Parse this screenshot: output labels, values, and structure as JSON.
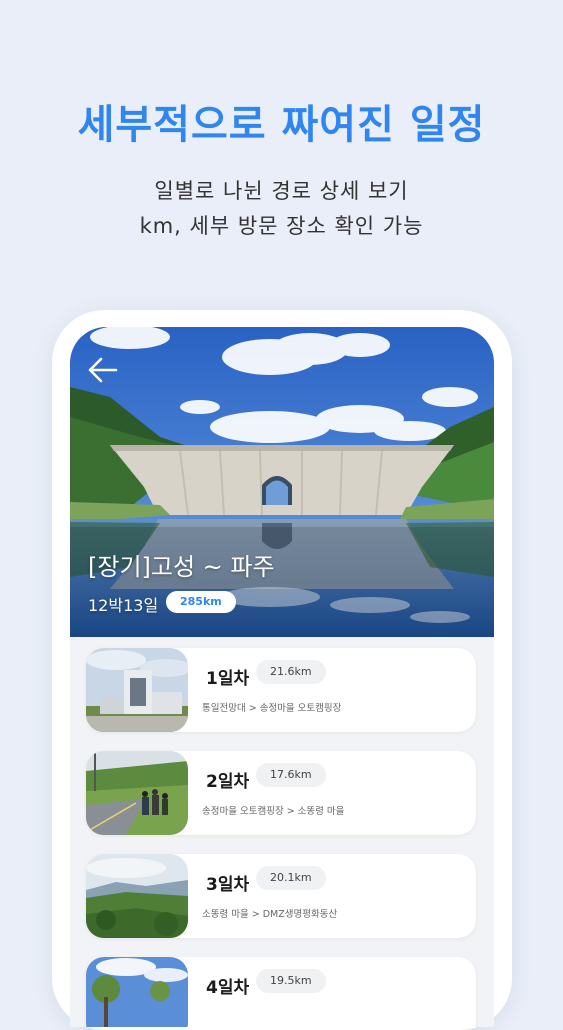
{
  "headline": "세부적으로 짜여진 일정",
  "subline1": "일별로 나뉜 경로 상세 보기",
  "subline2": "km, 세부 방문 장소 확인 가능",
  "route": {
    "title": "[장기]고성 ~ 파주",
    "duration": "12박13일",
    "total_km": "285km"
  },
  "days": [
    {
      "label": "1일차",
      "km": "21.6km",
      "path": "통일전망대 > 송정마을 오토캠핑장",
      "thumb": "observatory-building"
    },
    {
      "label": "2일차",
      "km": "17.6km",
      "path": "송정마을 오토캠핑장 > 소똥령 마을",
      "thumb": "hikers-on-road"
    },
    {
      "label": "3일차",
      "km": "20.1km",
      "path": "소똥령 마을 > DMZ생명평화동산",
      "thumb": "mountain-valley"
    },
    {
      "label": "4일차",
      "km": "19.5km",
      "path": "",
      "thumb": "trees-sky"
    }
  ],
  "icons": {
    "back": "back-arrow-icon"
  },
  "colors": {
    "accent": "#2f86f0",
    "background": "#e9eef8"
  }
}
